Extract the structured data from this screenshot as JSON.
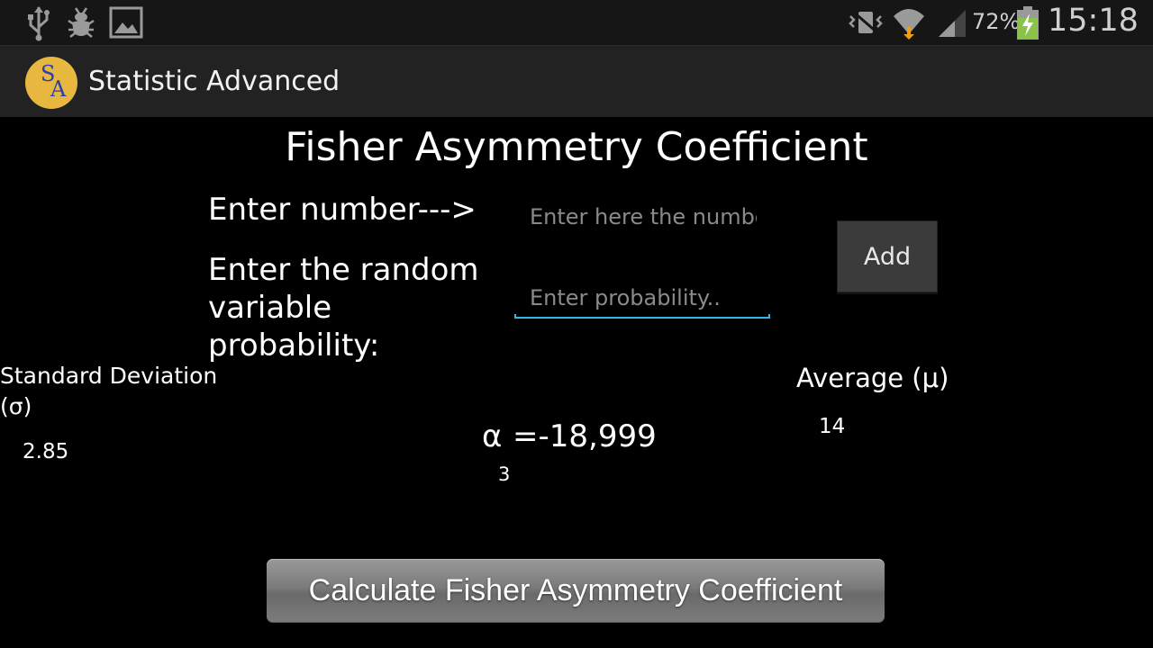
{
  "status_bar": {
    "battery_percent": "72%",
    "time": "15:18",
    "icons": [
      "usb-icon",
      "debug-icon",
      "image-icon",
      "vibrate-icon",
      "wifi-icon",
      "signal-icon",
      "battery-charging-icon"
    ]
  },
  "action_bar": {
    "logo_s": "S",
    "logo_a": "A",
    "title": "Statistic Advanced"
  },
  "main": {
    "title": "Fisher Asymmetry Coefficient",
    "number_label": "Enter number--->",
    "number_placeholder": "Enter here the number",
    "probability_label": "Enter the random variable probability:",
    "probability_placeholder": "Enter probability..",
    "add_label": "Add",
    "sd_label": "Standard Deviation (σ)",
    "sd_value": "2.85",
    "alpha_symbol": "α",
    "alpha_subscript": "3",
    "alpha_value": "=-18,999",
    "average_label": "Average (μ)",
    "average_value": "14",
    "calculate_label": "Calculate Fisher Asymmetry Coefficient"
  },
  "colors": {
    "accent": "#33b5e5",
    "logo_bg": "#e8b73f",
    "logo_text": "#2a3fb0",
    "charging": "#8bc34a"
  }
}
